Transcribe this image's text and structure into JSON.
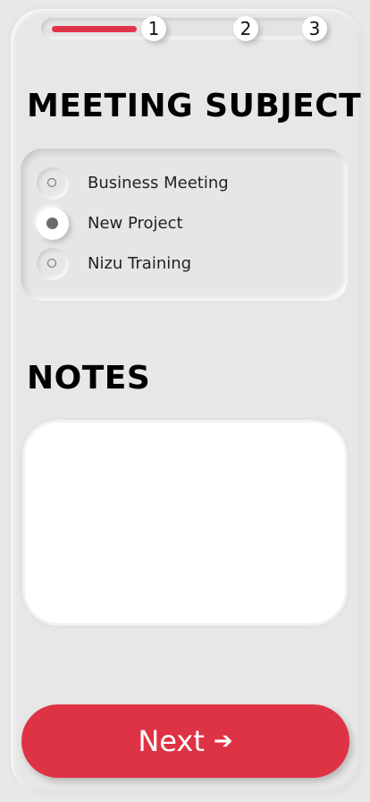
{
  "progress": {
    "current_step": 1,
    "total_steps": 3,
    "fill_fraction": 0.32,
    "steps": [
      {
        "label": "1"
      },
      {
        "label": "2"
      },
      {
        "label": "3"
      }
    ]
  },
  "subject": {
    "heading": "MEETING SUBJECT",
    "selected": "New Project",
    "options": [
      {
        "label": "Business Meeting"
      },
      {
        "label": "New Project"
      },
      {
        "label": "Nizu Training"
      }
    ]
  },
  "notes": {
    "heading": "NOTES",
    "value": "",
    "placeholder": ""
  },
  "actions": {
    "next_label": "Next",
    "next_icon": "arrow-right-icon"
  },
  "colors": {
    "accent": "#de3344",
    "background": "#e8e8e8"
  }
}
